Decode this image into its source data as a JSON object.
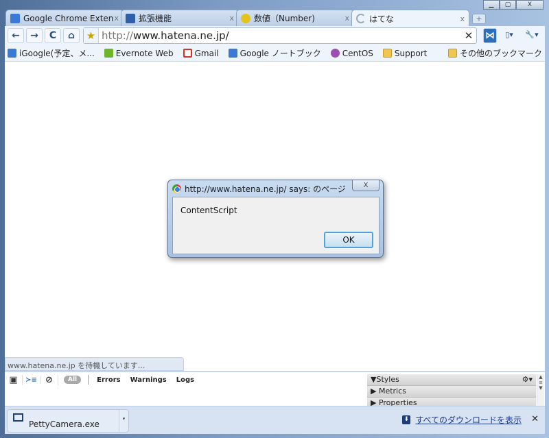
{
  "window": {
    "minimize": "▁",
    "maximize": "▢",
    "close": "X"
  },
  "tabs": [
    {
      "title": "Google Chrome Exten...",
      "icon": "google-icon",
      "color": "#3a79d6",
      "close": "x"
    },
    {
      "title": "拡張機能",
      "icon": "puzzle-icon",
      "color": "#2f5fa8",
      "close": "x"
    },
    {
      "title": "数値（Number)",
      "icon": "face-icon",
      "color": "#e6c31c",
      "close": "x"
    },
    {
      "title": "はてな",
      "icon": "loading-icon",
      "color": "#ffffff",
      "close": "x",
      "active": true
    }
  ],
  "toolbar": {
    "back": "←",
    "forward": "→",
    "reload": "C",
    "home": "⌂",
    "url_scheme": "http://",
    "url_host": "www.hatena.ne.jp/",
    "clear": "✕",
    "ext": "⋈",
    "page": "▯▾",
    "wrench": "🔧▾"
  },
  "bookmarks": [
    {
      "label": "iGoogle(予定、メ...",
      "color": "#3a79d6"
    },
    {
      "label": "Evernote Web",
      "color": "#6fb52c"
    },
    {
      "label": "Gmail",
      "color": "#d93025"
    },
    {
      "label": "Google ノートブック",
      "color": "#3a79d6"
    },
    {
      "label": "CentOS",
      "color": "#9b4fb0"
    },
    {
      "label": "Support",
      "color": "#f0c64e"
    }
  ],
  "other_bookmarks": "その他のブックマーク",
  "status": "www.hatena.ne.jp を待機しています...",
  "dialog": {
    "title": "http://www.hatena.ne.jp/ says: のページ",
    "close": "X",
    "message": "ContentScript",
    "ok": "OK"
  },
  "devtools": {
    "icons": [
      "▣",
      "≻≡",
      "⊘"
    ],
    "all": "All",
    "filters": [
      "Errors",
      "Warnings",
      "Logs"
    ],
    "panes": [
      {
        "label": "▼Styles"
      },
      {
        "label": "▶ Metrics"
      },
      {
        "label": "▶ Properties"
      }
    ],
    "gear": "⚙▾"
  },
  "download": {
    "file": "PettyCamera.exe",
    "show_all": "すべてのダウンロードを表示",
    "close": "✕"
  }
}
